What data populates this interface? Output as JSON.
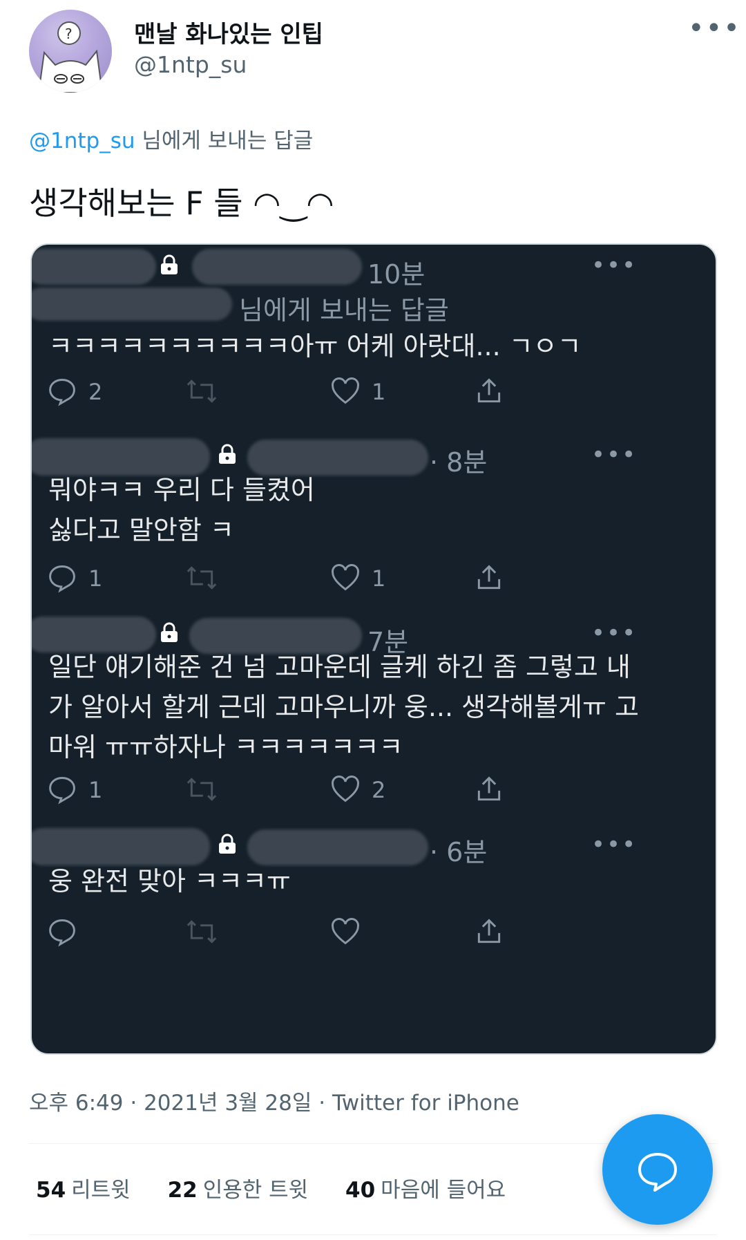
{
  "header": {
    "display_name": "맨날 화나있는 인팁",
    "handle": "@1ntp_su",
    "more_icon": "more-horizontal-icon"
  },
  "reply_to": {
    "mention": "@1ntp_su",
    "suffix": " 님에게 보내는 답글"
  },
  "tweet": {
    "text": "생각해보는 F 들 ◠‿◠"
  },
  "embedded_replies": [
    {
      "time": "10분",
      "reply_label": "님에게 보내는 답글",
      "lines": [
        "ㅋㅋㅋㅋㅋㅋㅋㅋㅋㅋ아ㅠ 어케 아랏대... ㄱㅇㄱ"
      ],
      "counts": {
        "reply": "2",
        "retweet": "",
        "like": "1"
      }
    },
    {
      "time": "· 8분",
      "lines": [
        "뭐야ㅋㅋ 우리 다 들켰어",
        "싫다고 말안함 ㅋ"
      ],
      "counts": {
        "reply": "1",
        "retweet": "",
        "like": "1"
      }
    },
    {
      "time": "7분",
      "lines": [
        "일단 얘기해준 건 넘 고마운데 글케 하긴 좀 그렇고 내",
        "가 알아서 할게 근데 고마우니까 웅... 생각해볼게ㅠ 고",
        "마워 ㅠㅠ하자나 ㅋㅋㅋㅋㅋㅋㅋ"
      ],
      "counts": {
        "reply": "1",
        "retweet": "",
        "like": "2"
      }
    },
    {
      "time": "· 6분",
      "lines": [
        "웅 완전 맞아 ㅋㅋㅋㅠ"
      ],
      "counts": {
        "reply": "",
        "retweet": "",
        "like": ""
      }
    }
  ],
  "meta": "오후 6:49 · 2021년 3월 28일 · Twitter for iPhone",
  "stats": [
    {
      "count": "54",
      "label": "리트윗"
    },
    {
      "count": "22",
      "label": "인용한 트윗"
    },
    {
      "count": "40",
      "label": "마음에 들어요"
    }
  ],
  "colors": {
    "accent": "#1d9bf0",
    "dark_bg": "#15202b",
    "muted": "#8b98a5"
  }
}
